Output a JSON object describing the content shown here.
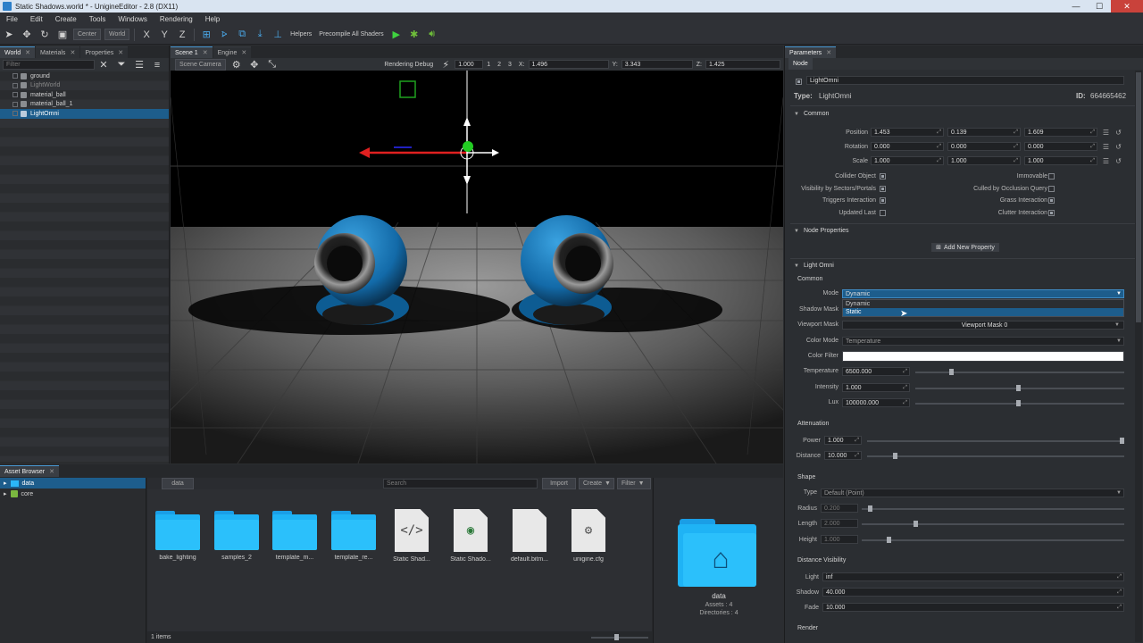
{
  "window": {
    "title": "Static Shadows.world * - UnigineEditor - 2.8 (DX11)",
    "minimize": "—",
    "maximize": "☐",
    "close": "✕"
  },
  "menu": [
    "File",
    "Edit",
    "Create",
    "Tools",
    "Windows",
    "Rendering",
    "Help"
  ],
  "toolbar": {
    "pivot": "Center",
    "space": "World",
    "axis_x": "X",
    "axis_y": "Y",
    "axis_z": "Z",
    "helpers": "Helpers",
    "precompile": "Precompile All Shaders"
  },
  "world_panel": {
    "tabs": [
      "World",
      "Materials",
      "Properties"
    ],
    "filter_placeholder": "Filter",
    "nodes": [
      {
        "name": "ground",
        "dim": false
      },
      {
        "name": "LightWorld",
        "dim": true
      },
      {
        "name": "material_ball",
        "dim": false
      },
      {
        "name": "material_ball_1",
        "dim": false
      },
      {
        "name": "LightOmni",
        "dim": false,
        "selected": true
      }
    ]
  },
  "scene_panel": {
    "tabs": [
      "Scene 1",
      "Engine"
    ],
    "camera": "Scene Camera",
    "rendering_debug": "Rendering Debug",
    "speed": "1.000",
    "views": [
      "1",
      "2",
      "3"
    ],
    "x_label": "X:",
    "x": "1.496",
    "y_label": "Y:",
    "y": "3.343",
    "z_label": "Z:",
    "z": "1.425"
  },
  "params": {
    "tab": "Parameters",
    "subtab": "Node",
    "node_name": "LightOmni",
    "type_label": "Type:",
    "type_value": "LightOmni",
    "id_label": "ID:",
    "id_value": "664665462",
    "common": {
      "title": "Common",
      "position_label": "Position",
      "position": [
        "1.453",
        "0.139",
        "1.609"
      ],
      "rotation_label": "Rotation",
      "rotation": [
        "0.000",
        "0.000",
        "0.000"
      ],
      "scale_label": "Scale",
      "scale": [
        "1.000",
        "1.000",
        "1.000"
      ],
      "flags_left": [
        {
          "label": "Collider Object",
          "on": true
        },
        {
          "label": "Visibility by Sectors/Portals",
          "on": true
        },
        {
          "label": "Triggers Interaction",
          "on": true
        },
        {
          "label": "Updated Last",
          "on": false
        }
      ],
      "flags_right": [
        {
          "label": "Immovable",
          "on": false
        },
        {
          "label": "Culled by Occlusion Query",
          "on": false
        },
        {
          "label": "Grass Interaction",
          "on": true
        },
        {
          "label": "Clutter Interaction",
          "on": true
        }
      ]
    },
    "node_properties": {
      "title": "Node Properties",
      "add_button": "Add New Property"
    },
    "light": {
      "title": "Light Omni",
      "common": "Common",
      "mode_label": "Mode",
      "mode_value": "Dynamic",
      "mode_options": [
        "Dynamic",
        "Static"
      ],
      "shadow_mask_label": "Shadow Mask",
      "viewport_mask_label": "Viewport Mask",
      "viewport_mask_value": "Viewport Mask 0",
      "color_mode_label": "Color Mode",
      "color_mode_value": "Temperature",
      "color_filter_label": "Color Filter",
      "temperature_label": "Temperature",
      "temperature": "6500.000",
      "intensity_label": "Intensity",
      "intensity": "1.000",
      "lux_label": "Lux",
      "lux": "100000.000",
      "attenuation": "Attenuation",
      "power_label": "Power",
      "power": "1.000",
      "distance_label": "Distance",
      "distance": "10.000",
      "shape": "Shape",
      "type_label": "Type",
      "type_value": "Default (Point)",
      "radius_label": "Radius",
      "radius": "0.200",
      "length_label": "Length",
      "length": "2.000",
      "height_label": "Height",
      "height": "1.000",
      "distance_visibility": "Distance Visibility",
      "dv_light_label": "Light",
      "dv_light": "inf",
      "dv_shadow_label": "Shadow",
      "dv_shadow": "40.000",
      "dv_fade_label": "Fade",
      "dv_fade": "10.000",
      "render": "Render"
    }
  },
  "asset_browser": {
    "tab": "Asset Browser",
    "tree": [
      "data",
      "core"
    ],
    "breadcrumb": "data",
    "search_placeholder": "Search",
    "import": "Import",
    "create": "Create",
    "filter": "Filter",
    "items": [
      {
        "label": "bake_lighting",
        "kind": "folder"
      },
      {
        "label": "samples_2",
        "kind": "folder"
      },
      {
        "label": "template_m...",
        "kind": "folder"
      },
      {
        "label": "template_re...",
        "kind": "folder"
      },
      {
        "label": "Static Shad...",
        "kind": "code"
      },
      {
        "label": "Static Shado...",
        "kind": "world"
      },
      {
        "label": "default.bitm...",
        "kind": "blank"
      },
      {
        "label": "unigine.cfg",
        "kind": "gear"
      }
    ],
    "status": "1 items",
    "preview_name": "data",
    "preview_assets": "Assets : 4",
    "preview_dirs": "Directories : 4"
  }
}
